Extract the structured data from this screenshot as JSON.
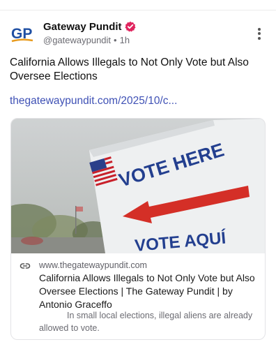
{
  "post": {
    "author": {
      "display_name": "Gateway Pundit",
      "handle": "@gatewaypundit",
      "separator": "•",
      "time": "1h",
      "avatar_text": "GP",
      "avatar_color": "#1f4fa3",
      "avatar_accent": "#e89b1e",
      "verified_color": "#e0245e"
    },
    "text": "California Allows Illegals to Not Only Vote but Also Oversee Elections",
    "link_text": "thegatewaypundit.com/2025/10/c...",
    "link_color": "#3f51b5",
    "more_icon": "more-vertical-icon"
  },
  "card": {
    "image_sign_text_line1": "VOTE HERE",
    "image_sign_text_line2": "VOTE AQUÍ",
    "domain": "www.thegatewaypundit.com",
    "title": "California Allows Illegals to Not Only Vote but Also Oversee Elections | The Gateway Pundit | by Antonio Graceffo",
    "description": "In small local elections, illegal aliens are already allowed to vote.",
    "link_icon": "link-icon"
  }
}
